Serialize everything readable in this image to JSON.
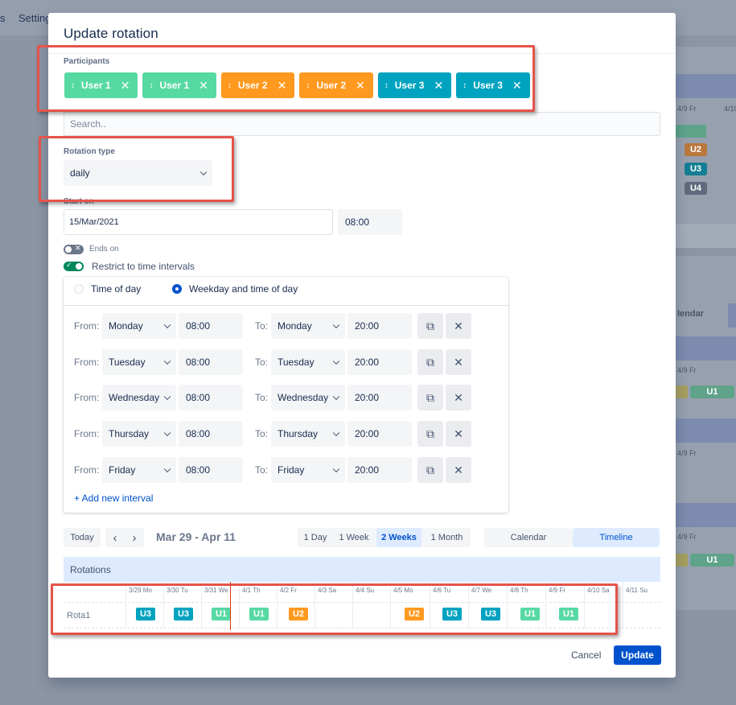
{
  "background": {
    "nav_items": [
      "s",
      "Setting"
    ],
    "right_labels": [
      "4/9 Fr",
      "4/10",
      "lendar",
      "4/9 Fr",
      "4/9 Fr",
      "4/9 Fr"
    ],
    "chips": [
      "U2",
      "U3",
      "U4",
      "U1",
      "U1"
    ]
  },
  "modal": {
    "title": "Update rotation",
    "participants_label": "Participants",
    "participants": [
      {
        "name": "User 1",
        "color": "#57d9a3"
      },
      {
        "name": "User 1",
        "color": "#57d9a3"
      },
      {
        "name": "User 2",
        "color": "#ff991f"
      },
      {
        "name": "User 2",
        "color": "#ff991f"
      },
      {
        "name": "User 3",
        "color": "#00a3bf"
      },
      {
        "name": "User 3",
        "color": "#00a3bf"
      }
    ],
    "search_placeholder": "Search..",
    "rotation_type_label": "Rotation type",
    "rotation_type_value": "daily",
    "start_label": "Start on",
    "start_date": "15/Mar/2021",
    "start_time": "08:00",
    "ends_on_label": "Ends on",
    "ends_on_enabled": false,
    "restrict_label": "Restrict to time intervals",
    "restrict_enabled": true,
    "interval_mode": {
      "option_time_of_day": "Time of day",
      "option_weekday": "Weekday and time of day",
      "selected": "Weekday and time of day"
    },
    "from_label": "From:",
    "to_label": "To:",
    "intervals": [
      {
        "from_day": "Monday",
        "from_time": "08:00",
        "to_day": "Monday",
        "to_time": "20:00"
      },
      {
        "from_day": "Tuesday",
        "from_time": "08:00",
        "to_day": "Tuesday",
        "to_time": "20:00"
      },
      {
        "from_day": "Wednesday",
        "from_time": "08:00",
        "to_day": "Wednesday",
        "to_time": "20:00"
      },
      {
        "from_day": "Thursday",
        "from_time": "08:00",
        "to_day": "Thursday",
        "to_time": "20:00"
      },
      {
        "from_day": "Friday",
        "from_time": "08:00",
        "to_day": "Friday",
        "to_time": "20:00"
      }
    ],
    "add_interval_label": "+ Add new interval",
    "toolbar": {
      "today": "Today",
      "prev": "‹",
      "next": "›",
      "range": "Mar 29 - Apr 11",
      "spans": [
        "1 Day",
        "1 Week",
        "2 Weeks",
        "1 Month"
      ],
      "selected_span": "2 Weeks",
      "views": [
        "Calendar",
        "Timeline"
      ],
      "selected_view": "Timeline"
    },
    "rotations_header": "Rotations",
    "timeline": {
      "row_label": "Rota1",
      "days": [
        "3/29 Mo",
        "3/30 Tu",
        "3/31 We",
        "4/1 Th",
        "4/2 Fr",
        "4/3 Sa",
        "4/4 Su",
        "4/5 Mo",
        "4/6 Tu",
        "4/7 We",
        "4/8 Th",
        "4/9 Fr",
        "4/10 Sa",
        "4/11 Su"
      ],
      "assignments": [
        "U3",
        "U3",
        "U1",
        "U1",
        "U2",
        "",
        "",
        "U2",
        "U3",
        "U3",
        "U1",
        "U1",
        "",
        ""
      ]
    },
    "cancel_label": "Cancel",
    "update_label": "Update"
  },
  "colors": {
    "accent": "#0052cc",
    "highlight": "#e5534b",
    "user1": "#57d9a3",
    "user2": "#ff991f",
    "user3": "#00a3bf"
  }
}
